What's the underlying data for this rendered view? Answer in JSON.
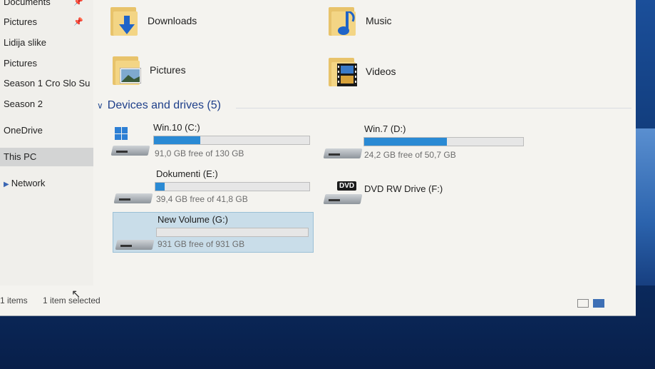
{
  "nav": {
    "items": [
      {
        "label": "Documents",
        "pinned": true
      },
      {
        "label": "Pictures",
        "pinned": true
      },
      {
        "label": "Lidija slike",
        "pinned": false
      },
      {
        "label": "Pictures",
        "pinned": false
      },
      {
        "label": "Season 1 Cro Slo Su",
        "pinned": false
      },
      {
        "label": "Season 2",
        "pinned": false
      },
      {
        "label": "OneDrive",
        "pinned": false
      },
      {
        "label": "This PC",
        "pinned": false,
        "selected": true
      },
      {
        "label": "Network",
        "pinned": false
      }
    ]
  },
  "folders": [
    {
      "label": "Downloads",
      "icon": "downloads-folder-icon"
    },
    {
      "label": "Music",
      "icon": "music-folder-icon"
    },
    {
      "label": "Pictures",
      "icon": "pictures-folder-icon"
    },
    {
      "label": "Videos",
      "icon": "videos-folder-icon"
    }
  ],
  "devices": {
    "header": "Devices and drives (5)",
    "drives": [
      {
        "name": "Win.10 (C:)",
        "free": "91,0 GB free of 130 GB",
        "used_fraction": 0.3,
        "icon": "windows-drive-icon"
      },
      {
        "name": "Win.7 (D:)",
        "free": "24,2 GB free of 50,7 GB",
        "used_fraction": 0.52,
        "icon": "hard-drive-icon"
      },
      {
        "name": "Dokumenti (E:)",
        "free": "39,4 GB free of 41,8 GB",
        "used_fraction": 0.06,
        "icon": "hard-drive-icon"
      },
      {
        "name": "DVD RW Drive (F:)",
        "free": "",
        "icon": "dvd-drive-icon",
        "badge": "DVD"
      },
      {
        "name": "New Volume (G:)",
        "free": "931 GB free of 931 GB",
        "used_fraction": 0.0,
        "icon": "hard-drive-icon",
        "selected": true
      }
    ]
  },
  "status": {
    "items_count": "1 items",
    "selected": "1 item selected"
  },
  "colors": {
    "bar_fill": "#2a8ad4",
    "section_header": "#1e3f8a",
    "selected_bg": "#c9dde9"
  }
}
